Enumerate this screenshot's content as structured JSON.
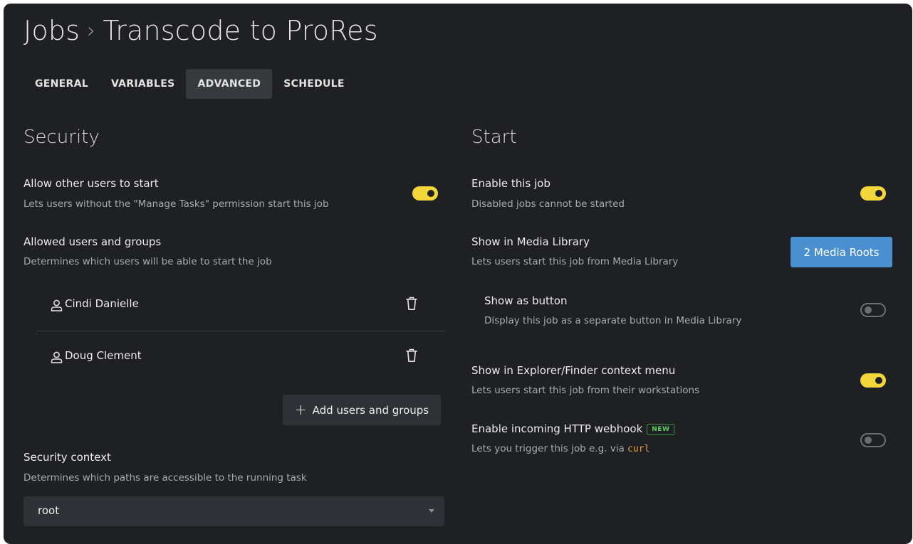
{
  "header": {
    "breadcrumb_root": "Jobs",
    "breadcrumb_sep": "›",
    "breadcrumb_current": "Transcode to ProRes"
  },
  "tabs": [
    {
      "label": "GENERAL",
      "active": false
    },
    {
      "label": "VARIABLES",
      "active": false
    },
    {
      "label": "ADVANCED",
      "active": true
    },
    {
      "label": "SCHEDULE",
      "active": false
    }
  ],
  "security": {
    "title": "Security",
    "allow_others": {
      "label": "Allow other users to start",
      "desc": "Lets users without the \"Manage Tasks\" permission start this job",
      "enabled": true
    },
    "allowed": {
      "label": "Allowed users and groups",
      "desc": "Determines which users will be able to start the job",
      "users": [
        {
          "name": "Cindi Danielle",
          "icon": "user-icon"
        },
        {
          "name": "Doug Clement",
          "icon": "user-icon"
        }
      ],
      "add_label": "Add users and groups"
    },
    "context": {
      "label": "Security context",
      "desc": "Determines which paths are accessible to the running task",
      "value": "root"
    }
  },
  "start": {
    "title": "Start",
    "enable_job": {
      "label": "Enable this job",
      "desc": "Disabled jobs cannot be started",
      "enabled": true
    },
    "media_library": {
      "label": "Show in Media Library",
      "desc": "Lets users start this job from Media Library",
      "button_label": "2 Media Roots"
    },
    "show_button": {
      "label": "Show as button",
      "desc": "Display this job as a separate button in Media Library",
      "enabled": false
    },
    "explorer": {
      "label": "Show in Explorer/Finder context menu",
      "desc": "Lets users start this job from their workstations",
      "enabled": true
    },
    "webhook": {
      "label": "Enable incoming HTTP webhook",
      "badge": "NEW",
      "desc_prefix": "Lets you trigger this job e.g. via ",
      "desc_code": "curl",
      "enabled": false
    }
  },
  "colors": {
    "background": "#1e2023",
    "toggle_on": "#f3d73a",
    "primary_button": "#4a90d0",
    "badge_green": "#5ed05e",
    "code_orange": "#e0a24a"
  }
}
